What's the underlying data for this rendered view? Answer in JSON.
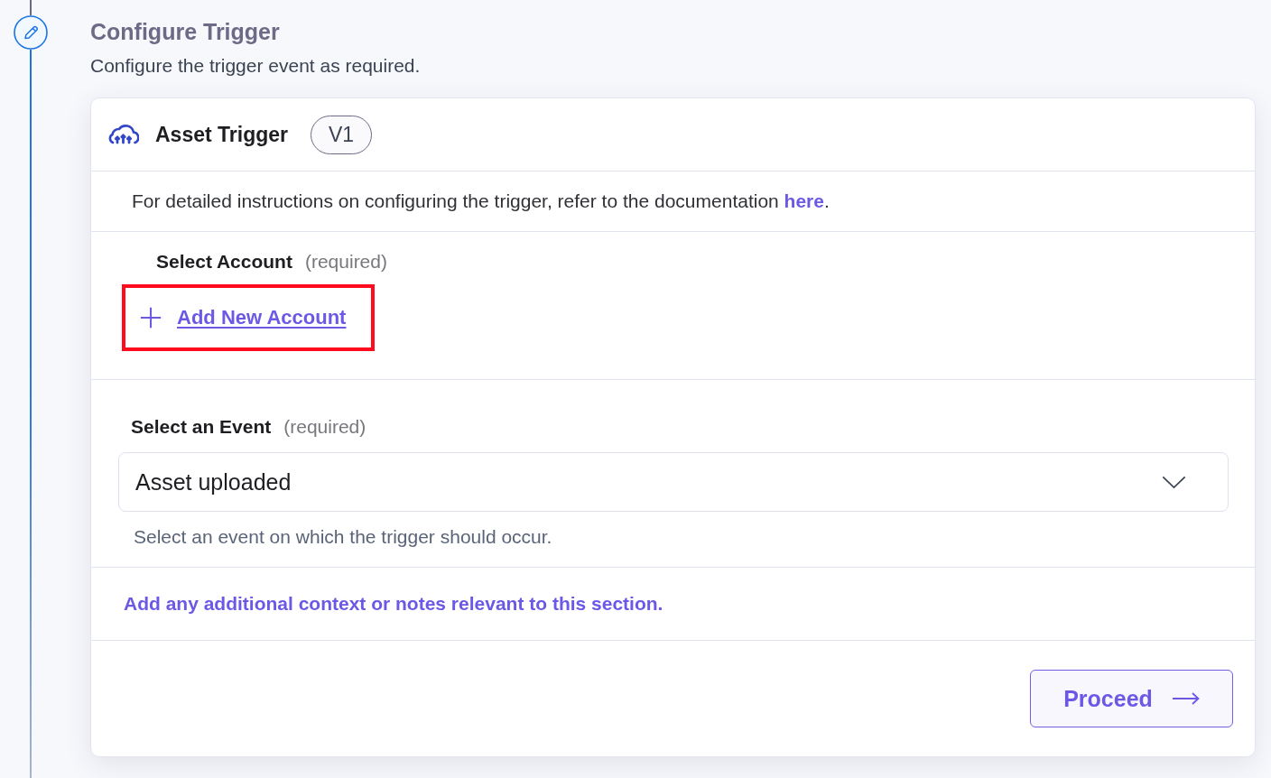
{
  "step": {
    "title": "Configure Trigger",
    "subtitle": "Configure the trigger event as required.",
    "active": true
  },
  "card": {
    "header": {
      "title": "Asset Trigger",
      "version": "V1"
    },
    "info": {
      "text": "For detailed instructions on configuring the trigger, refer to the documentation ",
      "link": "here",
      "suffix": "."
    },
    "account": {
      "label": "Select Account",
      "required": "(required)",
      "add_link": {
        "label": "Add New Account",
        "highlighted": true
      }
    },
    "event": {
      "label": "Select an Event",
      "required": "(required)",
      "value": "Asset uploaded",
      "hint": "Select an event on which the trigger should occur."
    },
    "notes_link": "Add any additional context or notes relevant to this section.",
    "proceed_button": "Proceed"
  }
}
